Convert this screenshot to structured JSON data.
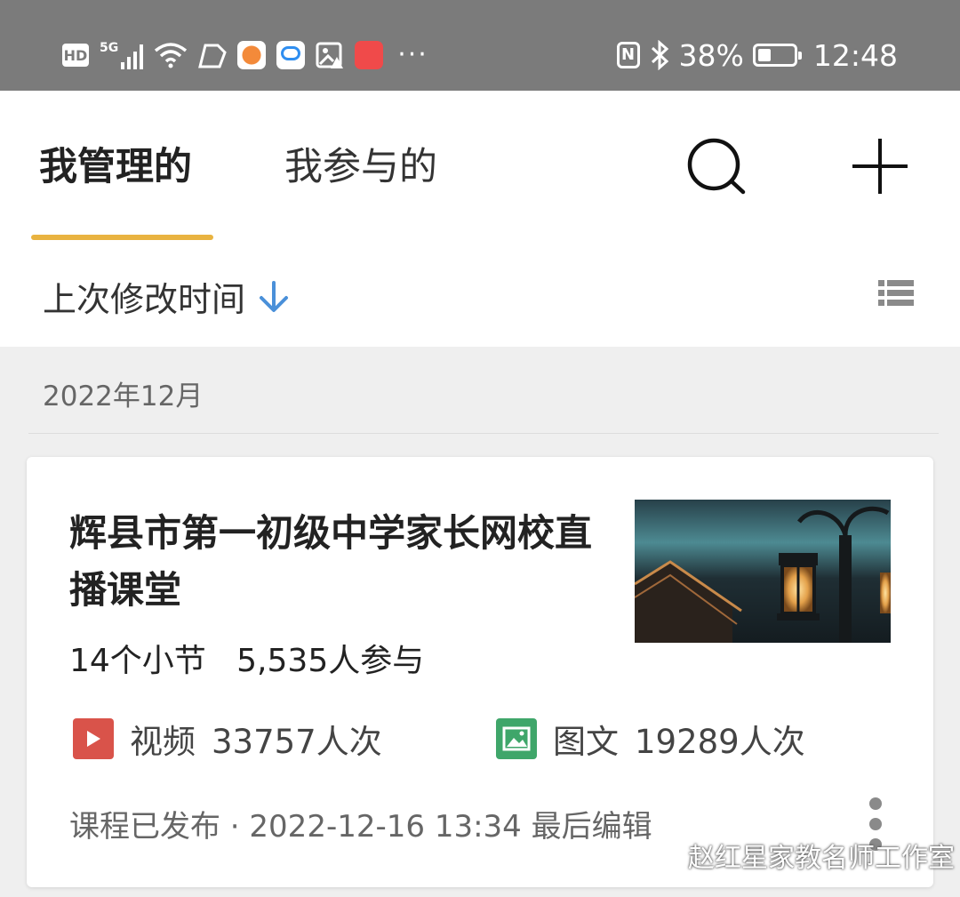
{
  "status_bar": {
    "hd": "HD",
    "network": "5G",
    "more": "···",
    "nfc": "N",
    "battery_percent": "38%",
    "battery_level": 0.38,
    "time": "12:48"
  },
  "tabs": [
    {
      "label": "我管理的",
      "active": true
    },
    {
      "label": "我参与的",
      "active": false
    }
  ],
  "sort": {
    "label": "上次修改时间"
  },
  "section": {
    "month": "2022年12月"
  },
  "course": {
    "title": "辉县市第一初级中学家长网校直播课堂",
    "sections": "14个小节",
    "participants": "5,535人参与",
    "metrics": [
      {
        "icon": "video-icon",
        "label": "视频",
        "value": "33757人次",
        "color": "#d9534a"
      },
      {
        "icon": "image-text-icon",
        "label": "图文",
        "value": "19289人次",
        "color": "#3fa66a"
      }
    ],
    "footer": "课程已发布 · 2022-12-16 13:34 最后编辑"
  },
  "watermark": "赵红星家教名师工作室",
  "colors": {
    "accent": "#e9b340",
    "sort_arrow": "#4a90d9",
    "status_bar": "#7b7b7b"
  }
}
